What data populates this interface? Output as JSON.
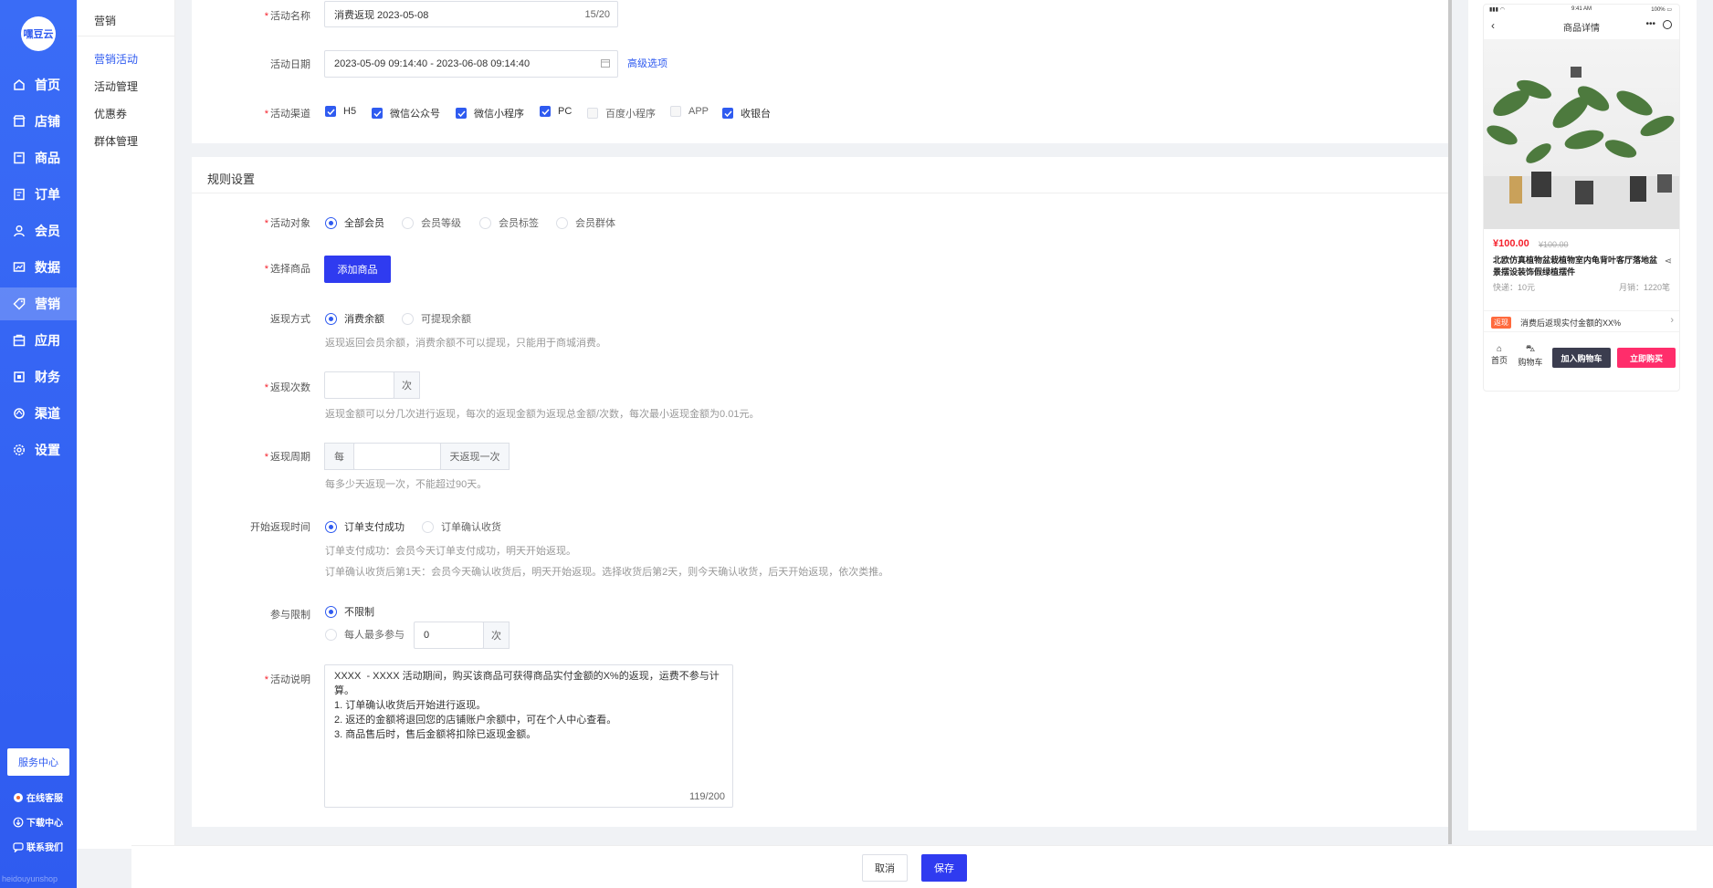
{
  "nav": {
    "logo": "嘿豆云",
    "items": [
      {
        "label": "首页",
        "icon": "home-icon"
      },
      {
        "label": "店铺",
        "icon": "shop-icon"
      },
      {
        "label": "商品",
        "icon": "goods-icon"
      },
      {
        "label": "订单",
        "icon": "order-icon"
      },
      {
        "label": "会员",
        "icon": "user-icon"
      },
      {
        "label": "数据",
        "icon": "chart-icon"
      },
      {
        "label": "营销",
        "icon": "tag-icon"
      },
      {
        "label": "应用",
        "icon": "app-icon"
      },
      {
        "label": "财务",
        "icon": "finance-icon"
      },
      {
        "label": "渠道",
        "icon": "channel-icon"
      },
      {
        "label": "设置",
        "icon": "gear-icon"
      }
    ],
    "active": "营销",
    "service_center": "服务中心",
    "links": [
      "在线客服",
      "下载中心",
      "联系我们"
    ],
    "footer": "heidouyunshop"
  },
  "subnav": {
    "title": "营销",
    "items": [
      "营销活动",
      "活动管理",
      "优惠券",
      "群体管理"
    ],
    "active": "营销活动"
  },
  "basic": {
    "name_label": "活动名称",
    "name_value": "消费返现 2023-05-08",
    "name_count": "15/20",
    "date_label": "活动日期",
    "date_value": "2023-05-09 09:14:40 - 2023-06-08 09:14:40",
    "advanced_link": "高级选项",
    "channel_label": "活动渠道",
    "channels": [
      {
        "label": "H5",
        "checked": true
      },
      {
        "label": "微信公众号",
        "checked": true
      },
      {
        "label": "微信小程序",
        "checked": true
      },
      {
        "label": "PC",
        "checked": true
      },
      {
        "label": "百度小程序",
        "checked": false
      },
      {
        "label": "APP",
        "checked": false
      },
      {
        "label": "收银台",
        "checked": true
      }
    ]
  },
  "rules": {
    "title": "规则设置",
    "target_label": "活动对象",
    "targets": [
      "全部会员",
      "会员等级",
      "会员标签",
      "会员群体"
    ],
    "goods_label": "选择商品",
    "add_goods": "添加商品",
    "method_label": "返现方式",
    "methods": [
      "消费余额",
      "可提现余额"
    ],
    "method_help": "返现返回会员余额，消费余额不可以提现，只能用于商城消费。",
    "times_label": "返现次数",
    "times_unit": "次",
    "times_help": "返现金额可以分几次进行返现，每次的返现金额为返现总金额/次数，每次最小返现金额为0.01元。",
    "cycle_label": "返现周期",
    "cycle_prefix": "每",
    "cycle_suffix": "天返现一次",
    "cycle_help": "每多少天返现一次，不能超过90天。",
    "start_label": "开始返现时间",
    "starts": [
      "订单支付成功",
      "订单确认收货"
    ],
    "start_help1": "订单支付成功：会员今天订单支付成功，明天开始返现。",
    "start_help2": "订单确认收货后第1天：会员今天确认收货后，明天开始返现。选择收货后第2天，则今天确认收货，后天开始返现，依次类推。",
    "limit_label": "参与限制",
    "limit_none": "不限制",
    "limit_each": "每人最多参与",
    "limit_value": "0",
    "limit_unit": "次",
    "desc_label": "活动说明",
    "desc_value": "XXXX  - XXXX 活动期间，购买该商品可获得商品实付金额的X%的返现，运费不参与计算。\n1. 订单确认收货后开始进行返现。\n2. 返还的金额将退回您的店铺账户余额中，可在个人中心查看。\n3. 商品售后时，售后金额将扣除已返现金额。",
    "desc_count": "119/200"
  },
  "preview": {
    "status_time": "9:41 AM",
    "status_battery": "100%",
    "title": "商品详情",
    "price": "¥100.00",
    "old_price": "¥100.00",
    "goods_name": "北欧仿真植物盆栽植物室内龟背叶客厅落地盆景摆设装饰假绿植摆件",
    "shipping": "快递：10元",
    "sold": "月销：1220笔",
    "rebate_tag": "返现",
    "rebate_text": "消费后返现实付金额的XX%",
    "tab_home": "首页",
    "tab_cart": "购物车",
    "add_cart": "加入购物车",
    "buy_now": "立即购买"
  },
  "footer": {
    "cancel": "取消",
    "save": "保存"
  },
  "colors": {
    "primary": "#2f5bf0",
    "button": "#2f3bf0",
    "required": "#f5222d",
    "buy": "#ff2d6b"
  }
}
